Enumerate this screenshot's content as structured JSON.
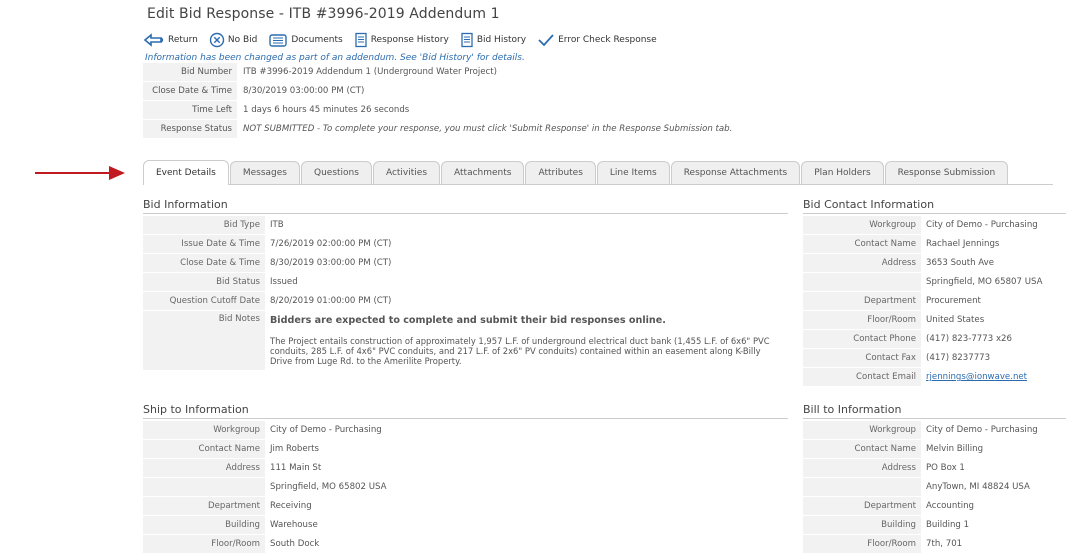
{
  "page": {
    "title": "Edit Bid Response - ITB #3996-2019 Addendum 1"
  },
  "toolbar": {
    "return": "Return",
    "no_bid": "No Bid",
    "documents": "Documents",
    "response_history": "Response History",
    "bid_history": "Bid History",
    "error_check": "Error Check Response"
  },
  "notice": "Information has been changed as part of an addendum. See 'Bid History' for details.",
  "header": {
    "bid_number": {
      "label": "Bid Number",
      "value": "ITB #3996-2019 Addendum 1 (Underground Water Project)"
    },
    "close_date": {
      "label": "Close Date & Time",
      "value": "8/30/2019 03:00:00 PM (CT)"
    },
    "time_left": {
      "label": "Time Left",
      "value": "1 days 6 hours 45 minutes 26 seconds"
    },
    "response_status": {
      "label": "Response Status",
      "value": "NOT SUBMITTED - To complete your response, you must click 'Submit Response' in the Response Submission tab."
    }
  },
  "tabs": [
    {
      "label": "Event Details"
    },
    {
      "label": "Messages"
    },
    {
      "label": "Questions"
    },
    {
      "label": "Activities"
    },
    {
      "label": "Attachments"
    },
    {
      "label": "Attributes"
    },
    {
      "label": "Line Items"
    },
    {
      "label": "Response Attachments"
    },
    {
      "label": "Plan Holders"
    },
    {
      "label": "Response Submission"
    }
  ],
  "bid_info": {
    "title": "Bid Information",
    "bid_type": {
      "label": "Bid Type",
      "value": "ITB"
    },
    "issue_date": {
      "label": "Issue Date & Time",
      "value": "7/26/2019 02:00:00 PM (CT)"
    },
    "close_date": {
      "label": "Close Date & Time",
      "value": "8/30/2019 03:00:00 PM (CT)"
    },
    "bid_status": {
      "label": "Bid Status",
      "value": "Issued"
    },
    "question_cutoff": {
      "label": "Question Cutoff Date",
      "value": "8/20/2019 01:00:00 PM (CT)"
    },
    "bid_notes": {
      "label": "Bid Notes",
      "headline": "Bidders are expected to complete and submit their bid responses online.",
      "description": "The Project entails construction of approximately 1,957 L.F. of underground electrical duct bank (1,455 L.F. of 6x6\" PVC conduits, 285 L.F. of 4x6\" PVC conduits, and 217 L.F. of 2x6\" PV conduits) contained within an easement along K-Billy Drive from Luge Rd. to the Amerilite Property."
    }
  },
  "bid_contact": {
    "title": "Bid Contact Information",
    "workgroup": {
      "label": "Workgroup",
      "value": "City of Demo - Purchasing"
    },
    "contact_name": {
      "label": "Contact Name",
      "value": "Rachael Jennings"
    },
    "address": {
      "label": "Address",
      "line1": "3653 South Ave",
      "line2": "Springfield, MO 65807 USA"
    },
    "department": {
      "label": "Department",
      "value": "Procurement"
    },
    "floor_room": {
      "label": "Floor/Room",
      "value": "United States"
    },
    "phone": {
      "label": "Contact Phone",
      "value": "(417) 823-7773 x26"
    },
    "fax": {
      "label": "Contact Fax",
      "value": "(417) 8237773"
    },
    "email": {
      "label": "Contact Email",
      "value": "rjennings@ionwave.net"
    }
  },
  "ship_to": {
    "title": "Ship to Information",
    "workgroup": {
      "label": "Workgroup",
      "value": "City of Demo - Purchasing"
    },
    "contact_name": {
      "label": "Contact Name",
      "value": "Jim Roberts"
    },
    "address": {
      "label": "Address",
      "line1": "111 Main St",
      "line2": "Springfield, MO 65802 USA"
    },
    "department": {
      "label": "Department",
      "value": "Receiving"
    },
    "building": {
      "label": "Building",
      "value": "Warehouse"
    },
    "floor_room": {
      "label": "Floor/Room",
      "value": "South Dock"
    }
  },
  "bill_to": {
    "title": "Bill to Information",
    "workgroup": {
      "label": "Workgroup",
      "value": "City of Demo - Purchasing"
    },
    "contact_name": {
      "label": "Contact Name",
      "value": "Melvin Billing"
    },
    "address": {
      "label": "Address",
      "line1": "PO Box 1",
      "line2": "AnyTown, MI 48824 USA"
    },
    "department": {
      "label": "Department",
      "value": "Accounting"
    },
    "building": {
      "label": "Building",
      "value": "Building 1"
    },
    "floor_room": {
      "label": "Floor/Room",
      "value": "7th, 701"
    }
  },
  "colors": {
    "accent_blue": "#2b6cb0",
    "status_red": "#d2242a",
    "arrow_red": "#c0191f",
    "label_bg": "#f2f2f2"
  }
}
